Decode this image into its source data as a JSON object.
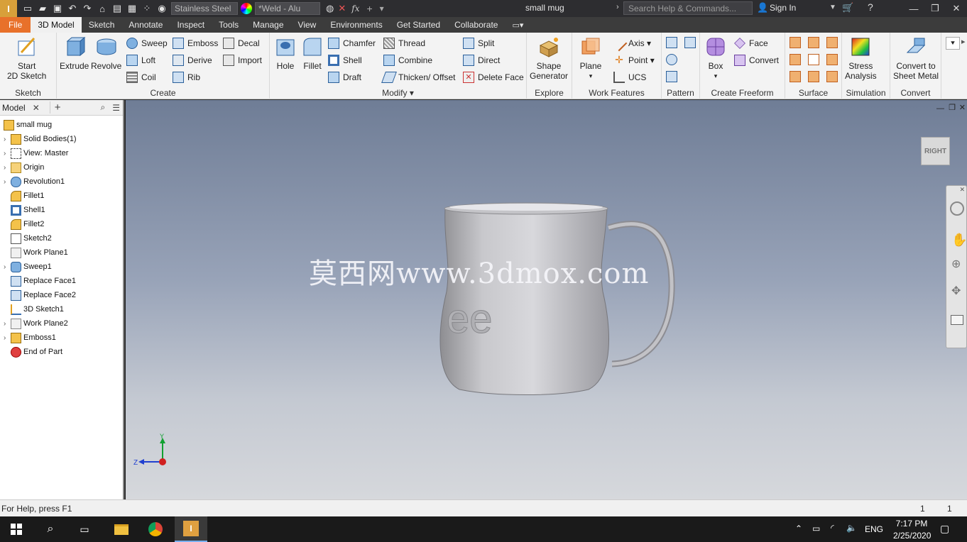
{
  "titlebar": {
    "material": "Stainless Steel",
    "appearance": "*Weld - Alu",
    "document_title": "small mug",
    "search_placeholder": "Search Help & Commands...",
    "sign_in": "Sign In"
  },
  "tabs": [
    "File",
    "3D Model",
    "Sketch",
    "Annotate",
    "Inspect",
    "Tools",
    "Manage",
    "View",
    "Environments",
    "Get Started",
    "Collaborate"
  ],
  "ribbon": {
    "sketch": {
      "title": "Sketch",
      "start": "Start",
      "sketch2d": "2D Sketch"
    },
    "create": {
      "title": "Create",
      "extrude": "Extrude",
      "revolve": "Revolve",
      "sweep": "Sweep",
      "emboss": "Emboss",
      "decal": "Decal",
      "loft": "Loft",
      "derive": "Derive",
      "import": "Import",
      "coil": "Coil",
      "rib": "Rib"
    },
    "modify": {
      "title": "Modify",
      "hole": "Hole",
      "fillet": "Fillet",
      "chamfer": "Chamfer",
      "thread": "Thread",
      "split": "Split",
      "shell": "Shell",
      "combine": "Combine",
      "direct": "Direct",
      "draft": "Draft",
      "thicken": "Thicken/ Offset",
      "delete_face": "Delete Face"
    },
    "explore": {
      "title": "Explore",
      "shape": "Shape",
      "generator": "Generator"
    },
    "work_features": {
      "title": "Work Features",
      "plane": "Plane",
      "axis": "Axis",
      "point": "Point",
      "ucs": "UCS"
    },
    "pattern": {
      "title": "Pattern"
    },
    "freeform": {
      "title": "Create Freeform",
      "box": "Box",
      "face": "Face",
      "convert": "Convert"
    },
    "surface": {
      "title": "Surface"
    },
    "simulation": {
      "title": "Simulation",
      "stress": "Stress",
      "analysis": "Analysis"
    },
    "convert": {
      "title": "Convert",
      "convert_to": "Convert to",
      "sheet_metal": "Sheet Metal"
    }
  },
  "browser": {
    "tab": "Model",
    "items": [
      {
        "label": "small mug",
        "icon": "part-icon"
      },
      {
        "label": "Solid Bodies(1)",
        "icon": "solid-bodies-icon"
      },
      {
        "label": "View: Master",
        "icon": "view-icon"
      },
      {
        "label": "Origin",
        "icon": "folder-icon"
      },
      {
        "label": "Revolution1",
        "icon": "revolve-feature-icon"
      },
      {
        "label": "Fillet1",
        "icon": "fillet-feature-icon"
      },
      {
        "label": "Shell1",
        "icon": "shell-feature-icon"
      },
      {
        "label": "Fillet2",
        "icon": "fillet-feature-icon"
      },
      {
        "label": "Sketch2",
        "icon": "sketch-icon"
      },
      {
        "label": "Work Plane1",
        "icon": "work-plane-icon"
      },
      {
        "label": "Sweep1",
        "icon": "sweep-feature-icon"
      },
      {
        "label": "Replace Face1",
        "icon": "replace-face-icon"
      },
      {
        "label": "Replace Face2",
        "icon": "replace-face-icon"
      },
      {
        "label": "3D Sketch1",
        "icon": "3d-sketch-icon"
      },
      {
        "label": "Work Plane2",
        "icon": "work-plane-icon"
      },
      {
        "label": "Emboss1",
        "icon": "emboss-feature-icon"
      },
      {
        "label": "End of Part",
        "icon": "end-of-part-icon"
      }
    ]
  },
  "viewport": {
    "viewcube": "RIGHT",
    "watermark": "莫西网www.3dmox.com",
    "embossed_text": "ee",
    "axis_y": "Y",
    "axis_z": "Z"
  },
  "statusbar": {
    "help": "For Help, press F1",
    "count1": "1",
    "count2": "1"
  },
  "taskbar": {
    "lang": "ENG",
    "time": "7:17 PM",
    "date": "2/25/2020"
  },
  "colors": {
    "accent": "#e8712a",
    "titlebar": "#2d2d30",
    "ribbon": "#f3f3f3"
  }
}
